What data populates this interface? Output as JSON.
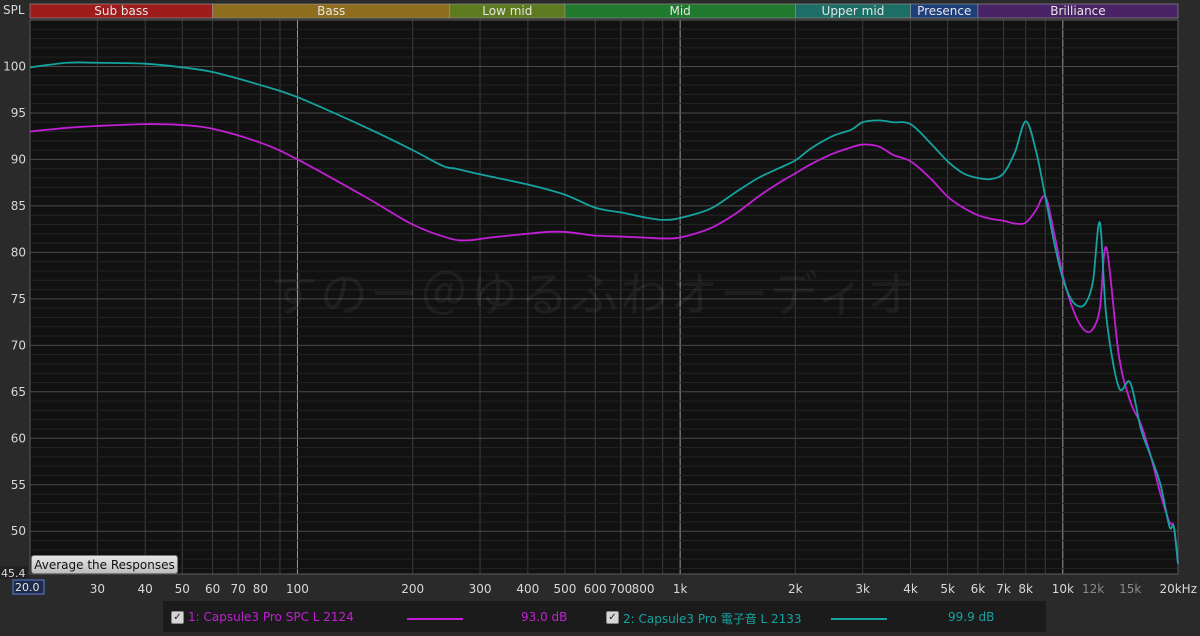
{
  "watermark": "すのー＠ゆるふわオーディオ",
  "average_button_label": "Average the Responses",
  "chart_data": {
    "type": "line",
    "ylabel": "SPL",
    "x_unit": "Hz",
    "xscale": "log",
    "xlim": [
      20,
      20000
    ],
    "ylim": [
      45.4,
      105
    ],
    "ymin_label": "45.4",
    "xmin_label": "20.0",
    "grid": true,
    "yticks": [
      50,
      55,
      60,
      65,
      70,
      75,
      80,
      85,
      90,
      95,
      100
    ],
    "xticks": [
      {
        "value": 30,
        "label": "30",
        "dim": false
      },
      {
        "value": 40,
        "label": "40",
        "dim": false
      },
      {
        "value": 50,
        "label": "50",
        "dim": false
      },
      {
        "value": 60,
        "label": "60",
        "dim": false
      },
      {
        "value": 70,
        "label": "70",
        "dim": false
      },
      {
        "value": 80,
        "label": "80",
        "dim": false
      },
      {
        "value": 100,
        "label": "100",
        "dim": false
      },
      {
        "value": 200,
        "label": "200",
        "dim": false
      },
      {
        "value": 300,
        "label": "300",
        "dim": false
      },
      {
        "value": 400,
        "label": "400",
        "dim": false
      },
      {
        "value": 500,
        "label": "500",
        "dim": false
      },
      {
        "value": 600,
        "label": "600",
        "dim": false
      },
      {
        "value": 700,
        "label": "700",
        "dim": false
      },
      {
        "value": 800,
        "label": "800",
        "dim": false
      },
      {
        "value": 1000,
        "label": "1k",
        "dim": false
      },
      {
        "value": 2000,
        "label": "2k",
        "dim": false
      },
      {
        "value": 3000,
        "label": "3k",
        "dim": false
      },
      {
        "value": 4000,
        "label": "4k",
        "dim": false
      },
      {
        "value": 5000,
        "label": "5k",
        "dim": false
      },
      {
        "value": 6000,
        "label": "6k",
        "dim": false
      },
      {
        "value": 7000,
        "label": "7k",
        "dim": false
      },
      {
        "value": 8000,
        "label": "8k",
        "dim": false
      },
      {
        "value": 10000,
        "label": "10k",
        "dim": false
      },
      {
        "value": 12000,
        "label": "12k",
        "dim": true
      },
      {
        "value": 15000,
        "label": "15k",
        "dim": true
      },
      {
        "value": 20000,
        "label": "20kHz",
        "dim": false
      }
    ],
    "bands": [
      {
        "name": "Sub bass",
        "from": 20,
        "to": 60,
        "color": "#9e1c1c"
      },
      {
        "name": "Bass",
        "from": 60,
        "to": 250,
        "color": "#8f6d1e"
      },
      {
        "name": "Low mid",
        "from": 250,
        "to": 500,
        "color": "#5d7a1e"
      },
      {
        "name": "Mid",
        "from": 500,
        "to": 2000,
        "color": "#1f7a2e"
      },
      {
        "name": "Upper mid",
        "from": 2000,
        "to": 4000,
        "color": "#1c6e66"
      },
      {
        "name": "Presence",
        "from": 4000,
        "to": 6000,
        "color": "#1e3f7a"
      },
      {
        "name": "Brilliance",
        "from": 6000,
        "to": 20000,
        "color": "#4a2366"
      }
    ],
    "series": [
      {
        "name": "1: Capsule3 Pro SPC L 2124",
        "level": "93.0 dB",
        "color": "#c21fd6",
        "x": [
          20,
          25,
          30,
          40,
          50,
          60,
          80,
          100,
          150,
          200,
          250,
          280,
          320,
          400,
          450,
          500,
          550,
          600,
          700,
          800,
          900,
          1000,
          1200,
          1400,
          1600,
          1800,
          2000,
          2200,
          2500,
          2800,
          3000,
          3300,
          3600,
          4000,
          4500,
          5000,
          5500,
          6000,
          6500,
          7000,
          7500,
          8000,
          8500,
          9000,
          9500,
          10000,
          10500,
          11000,
          11500,
          12000,
          12500,
          13000,
          14000,
          15000,
          16000,
          17000,
          18000,
          19000,
          19500,
          20000
        ],
        "y": [
          93.0,
          93.4,
          93.6,
          93.8,
          93.7,
          93.3,
          91.8,
          90.0,
          86.0,
          83.0,
          81.5,
          81.3,
          81.6,
          82.0,
          82.2,
          82.2,
          82.0,
          81.8,
          81.7,
          81.6,
          81.5,
          81.6,
          82.6,
          84.2,
          86.0,
          87.4,
          88.5,
          89.5,
          90.6,
          91.3,
          91.6,
          91.4,
          90.5,
          89.8,
          88.0,
          86.0,
          84.8,
          84.0,
          83.6,
          83.4,
          83.1,
          83.2,
          84.5,
          86.0,
          82.0,
          77.5,
          74.5,
          72.5,
          71.5,
          71.8,
          74.0,
          80.5,
          69.0,
          64.0,
          61.5,
          58.0,
          54.0,
          51.0,
          50.5,
          46.5
        ]
      },
      {
        "name": "2: Capsule3 Pro 電子音 L 2133",
        "level": "99.9 dB",
        "color": "#15a3a0",
        "x": [
          20,
          25,
          30,
          40,
          50,
          60,
          80,
          100,
          150,
          200,
          240,
          260,
          300,
          400,
          500,
          600,
          700,
          800,
          900,
          1000,
          1200,
          1400,
          1600,
          1800,
          2000,
          2200,
          2500,
          2800,
          3000,
          3300,
          3600,
          4000,
          4500,
          5000,
          5500,
          6000,
          6500,
          7000,
          7500,
          8000,
          8500,
          9000,
          9500,
          10000,
          10500,
          11000,
          11500,
          12000,
          12500,
          13000,
          14000,
          15000,
          16000,
          17000,
          18000,
          19000,
          19500,
          20000
        ],
        "y": [
          99.9,
          100.4,
          100.4,
          100.3,
          99.9,
          99.4,
          98.0,
          96.7,
          93.5,
          91.0,
          89.3,
          89.0,
          88.4,
          87.3,
          86.2,
          84.8,
          84.3,
          83.8,
          83.5,
          83.7,
          84.7,
          86.5,
          88.0,
          89.0,
          89.9,
          91.2,
          92.5,
          93.2,
          94.0,
          94.2,
          94.0,
          93.8,
          91.8,
          89.8,
          88.5,
          88.0,
          87.9,
          88.5,
          90.8,
          94.1,
          91.0,
          86.0,
          81.0,
          77.2,
          75.0,
          74.2,
          74.6,
          77.0,
          83.2,
          73.0,
          65.5,
          66.0,
          61.0,
          58.0,
          55.0,
          50.5,
          50.5,
          46.5
        ]
      }
    ]
  }
}
